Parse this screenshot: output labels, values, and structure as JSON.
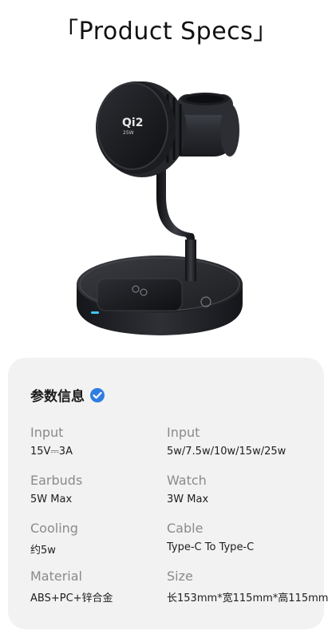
{
  "header": {
    "title": "「Product Specs」"
  },
  "product": {
    "image_name": "wireless-charger-stand",
    "badge_text": "Qi2",
    "badge_subtext": "25W"
  },
  "specs_card": {
    "title": "参数信息",
    "icon": "verified-check-icon",
    "accent_color": "#2f7de1",
    "items": [
      {
        "label": "Input",
        "value": "15V⎓3A"
      },
      {
        "label": "Input",
        "value": "5w/7.5w/10w/15w/25w"
      },
      {
        "label": "Earbuds",
        "value": "5W Max"
      },
      {
        "label": "Watch",
        "value": "3W Max"
      },
      {
        "label": "Cooling",
        "value": "约5w"
      },
      {
        "label": "Cable",
        "value": "Type-C To Type-C"
      },
      {
        "label": "Material",
        "value": "ABS+PC+锌合金"
      },
      {
        "label": "Size",
        "value": "长153mm*宽115mm*高115mm"
      }
    ]
  }
}
